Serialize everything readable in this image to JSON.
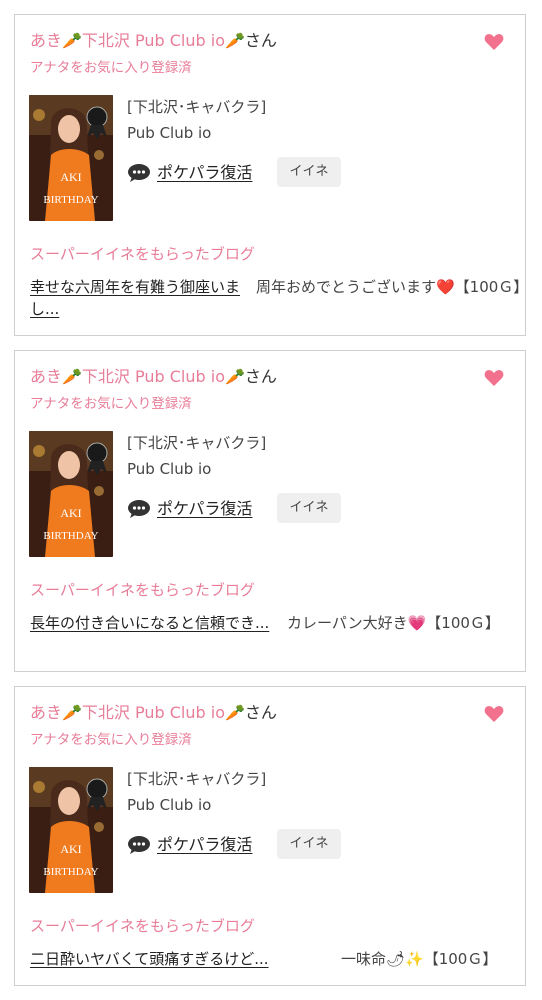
{
  "posts": [
    {
      "user_name": "あき🥕下北沢 Pub Club io🥕",
      "san": "さん",
      "fav_status": "アナタをお気に入り登録済",
      "genre": "[下北沢･キャバクラ]",
      "shop": "Pub Club io",
      "pokepara_label": "ポケパラ復活",
      "iine_label": "イイネ",
      "super_title": "スーパーイイネをもらったブログ",
      "blog_title": "幸せな六周年を有難う御座いまし...",
      "comment": "周年おめでとうございます❤️【100Ｇ】"
    },
    {
      "user_name": "あき🥕下北沢 Pub Club io🥕",
      "san": "さん",
      "fav_status": "アナタをお気に入り登録済",
      "genre": "[下北沢･キャバクラ]",
      "shop": "Pub Club io",
      "pokepara_label": "ポケパラ復活",
      "iine_label": "イイネ",
      "super_title": "スーパーイイネをもらったブログ",
      "blog_title": "長年の付き合いになると信頼でき...",
      "comment": "カレーパン大好き💗【100Ｇ】"
    },
    {
      "user_name": "あき🥕下北沢 Pub Club io🥕",
      "san": "さん",
      "fav_status": "アナタをお気に入り登録済",
      "genre": "[下北沢･キャバクラ]",
      "shop": "Pub Club io",
      "pokepara_label": "ポケパラ復活",
      "iine_label": "イイネ",
      "super_title": "スーパーイイネをもらったブログ",
      "blog_title": "二日酔いヤバくて頭痛すぎるけど...",
      "comment": "一味命🌶✨【100Ｇ】"
    }
  ],
  "photo_text": [
    "AKI",
    "BIRTHDAY"
  ],
  "icons": {
    "heart": "heart-icon",
    "chat": "chat-bubble-icon"
  },
  "colors": {
    "accent_pink": "#e87d98",
    "heart": "#f2728e",
    "iine_bg": "#efefef",
    "border": "#cfcfcf"
  }
}
